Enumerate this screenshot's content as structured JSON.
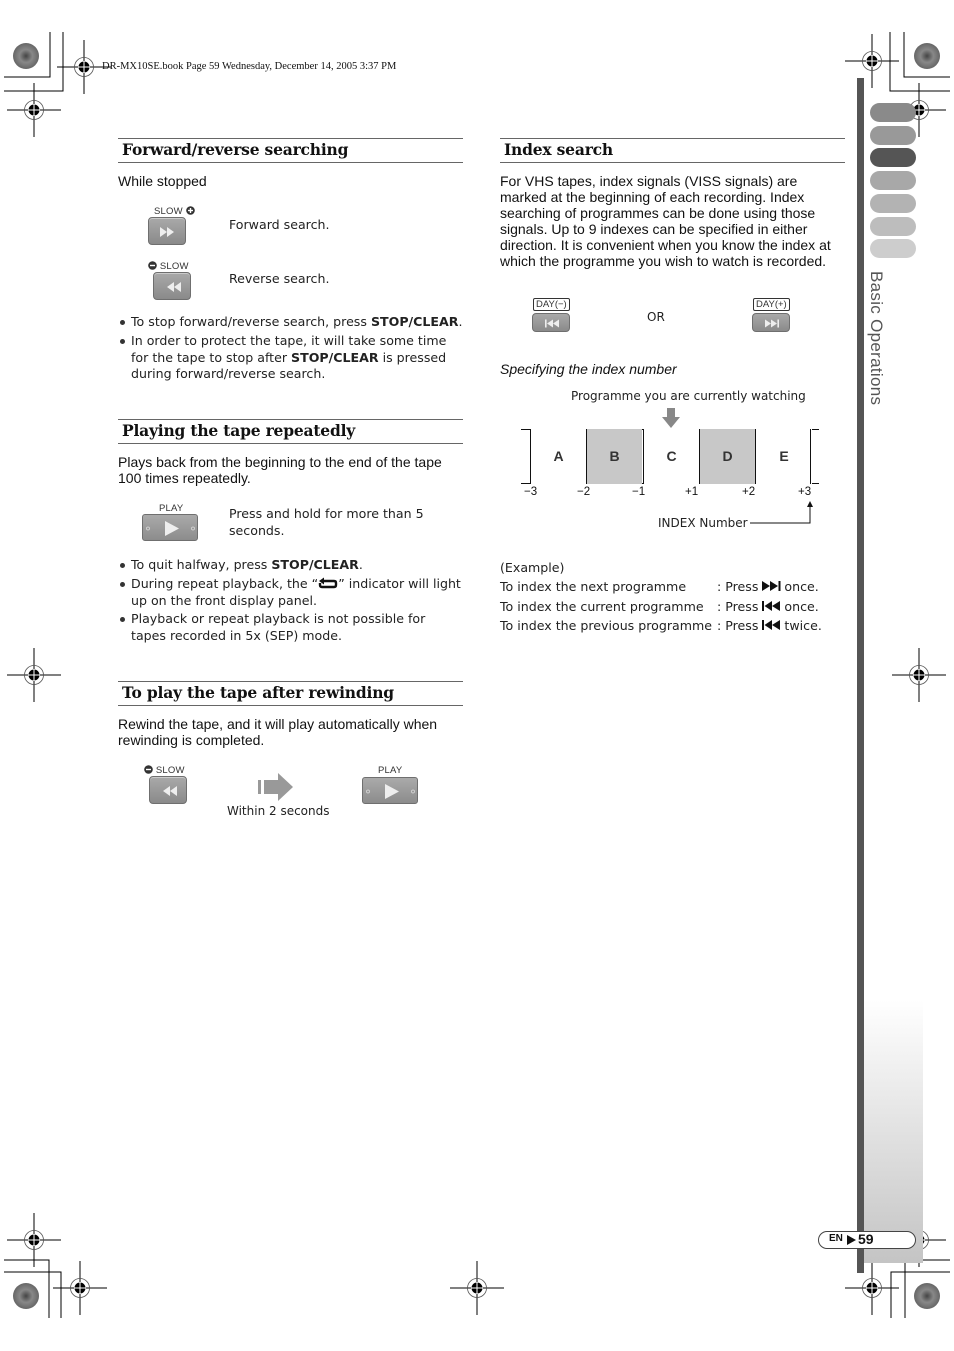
{
  "header": {
    "file_info": "DR-MX10SE.book  Page 59  Wednesday, December 14, 2005  3:37 PM"
  },
  "side_tab": {
    "title": "Basic Operations",
    "tab_colors": [
      "#8a8a8a",
      "#999999",
      "#555555",
      "#a8a8a8",
      "#b3b3b3",
      "#bdbdbd",
      "#cdcdcd"
    ],
    "active_tab_index": 2,
    "bar_color": "#555555"
  },
  "page_badge": {
    "lang": "EN",
    "page_number": "59"
  },
  "sections": {
    "forward_reverse": {
      "heading": "Forward/reverse searching",
      "intro": "While stopped",
      "forward_button_label": "SLOW",
      "forward_desc": "Forward search.",
      "reverse_button_label": "SLOW",
      "reverse_desc": "Reverse search.",
      "bullets": [
        {
          "pre": "To stop forward/reverse search, press ",
          "bold": "STOP/CLEAR",
          "post": "."
        },
        {
          "pre": "In order to protect the tape, it will take some time for the tape to stop after ",
          "bold": "STOP/CLEAR",
          "post": " is pressed during forward/reverse search."
        }
      ]
    },
    "repeat": {
      "heading": "Playing the tape repeatedly",
      "intro": "Plays back from the beginning to the end of the tape 100 times repeatedly.",
      "play_button_label": "PLAY",
      "play_desc": "Press and hold for more than 5 seconds.",
      "bullet1_pre": "To quit halfway, press ",
      "bullet1_bold": "STOP/CLEAR",
      "bullet1_post": ".",
      "bullet2_pre": "During repeat playback, the “",
      "bullet2_post": "” indicator will light up on the front display panel.",
      "bullet3": "Playback or repeat playback is not possible for tapes recorded in 5x (SEP) mode."
    },
    "after_rewind": {
      "heading": "To play the tape after rewinding",
      "intro": "Rewind the tape, and it will play automatically when rewinding is completed.",
      "rewind_button_label": "SLOW",
      "play_button_label": "PLAY",
      "arrow_caption": "Within 2 seconds"
    },
    "index_search": {
      "heading": "Index search",
      "intro": "For VHS tapes, index signals (VISS signals) are marked at the beginning of each recording. Index searching of programmes can be done using those signals. Up to 9 indexes can be specified in either direction. It is convenient when you know the index at which the programme you wish to watch is recorded.",
      "day_minus_label": "DAY(−)",
      "day_plus_label": "DAY(+)",
      "or_label": "OR",
      "subheading": "Specifying the index number",
      "diagram": {
        "current_label": "Programme you are currently watching",
        "programmes": [
          {
            "label": "A",
            "shaded": false
          },
          {
            "label": "B",
            "shaded": true
          },
          {
            "label": "C",
            "shaded": false
          },
          {
            "label": "D",
            "shaded": true
          },
          {
            "label": "E",
            "shaded": false
          }
        ],
        "current_programme": "C",
        "index_numbers": [
          "−3",
          "−2",
          "−1",
          "+1",
          "+2",
          "+3"
        ],
        "index_caption": "INDEX Number"
      },
      "example_label": "(Example)",
      "examples": [
        {
          "task": "To index the next programme",
          "press": ": Press",
          "icon": "skip-forward-icon",
          "count": "once."
        },
        {
          "task": "To index the current programme",
          "press": ": Press",
          "icon": "skip-back-icon",
          "count": "once."
        },
        {
          "task": "To index the previous programme",
          "press": ": Press",
          "icon": "skip-back-icon",
          "count": "twice."
        }
      ]
    }
  }
}
